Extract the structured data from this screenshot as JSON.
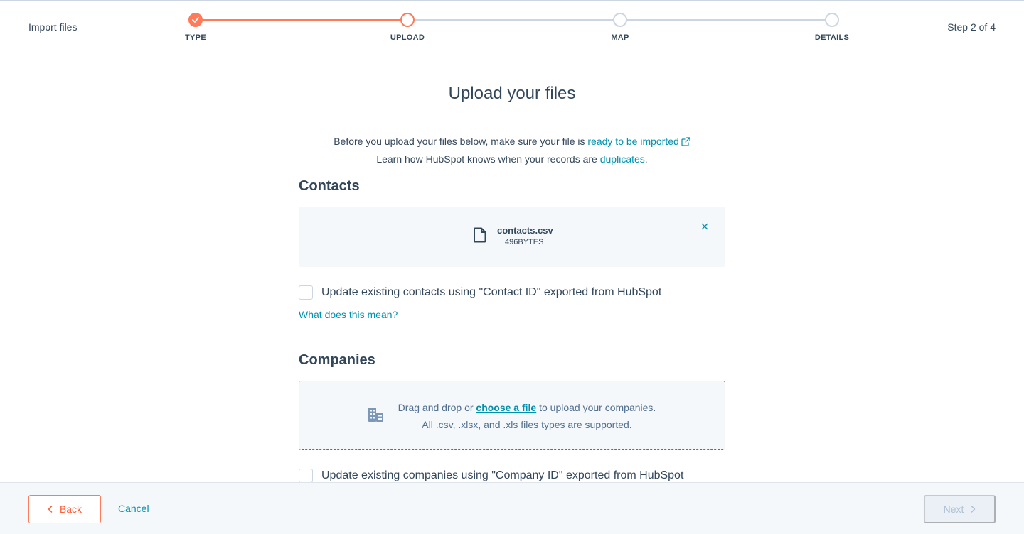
{
  "header": {
    "title": "Import files",
    "step_indicator": "Step 2 of 4"
  },
  "stepper": {
    "steps": [
      {
        "label": "TYPE",
        "state": "completed"
      },
      {
        "label": "UPLOAD",
        "state": "active"
      },
      {
        "label": "MAP",
        "state": "upcoming"
      },
      {
        "label": "DETAILS",
        "state": "upcoming"
      }
    ]
  },
  "main": {
    "title": "Upload your files",
    "intro_line1_prefix": "Before you upload your files below, make sure your file is ",
    "intro_line1_link": "ready to be imported",
    "intro_line2_prefix": "Learn how HubSpot knows when your records are ",
    "intro_line2_link": "duplicates",
    "intro_line2_suffix": "."
  },
  "contacts": {
    "title": "Contacts",
    "file_name": "contacts.csv",
    "file_size": "496BYTES",
    "update_checkbox_label": "Update existing contacts using \"Contact ID\" exported from HubSpot",
    "update_checked": false,
    "help_link": "What does this mean?"
  },
  "companies": {
    "title": "Companies",
    "dropzone_prefix": "Drag and drop or ",
    "dropzone_link": "choose a file",
    "dropzone_suffix": " to upload your companies.",
    "dropzone_formats": "All .csv, .xlsx, and .xls files types are supported.",
    "update_checkbox_label": "Update existing companies using \"Company ID\" exported from HubSpot",
    "update_checked": false
  },
  "footer": {
    "back_label": "Back",
    "cancel_label": "Cancel",
    "next_label": "Next",
    "next_disabled": true
  },
  "colors": {
    "accent": "#ff7a59",
    "link": "#0091ae",
    "text": "#33475b",
    "panel": "#f5f8fa"
  },
  "icons": [
    "check-icon",
    "external-link-icon",
    "file-icon",
    "close-icon",
    "building-icon",
    "chevron-left-icon",
    "chevron-right-icon"
  ]
}
